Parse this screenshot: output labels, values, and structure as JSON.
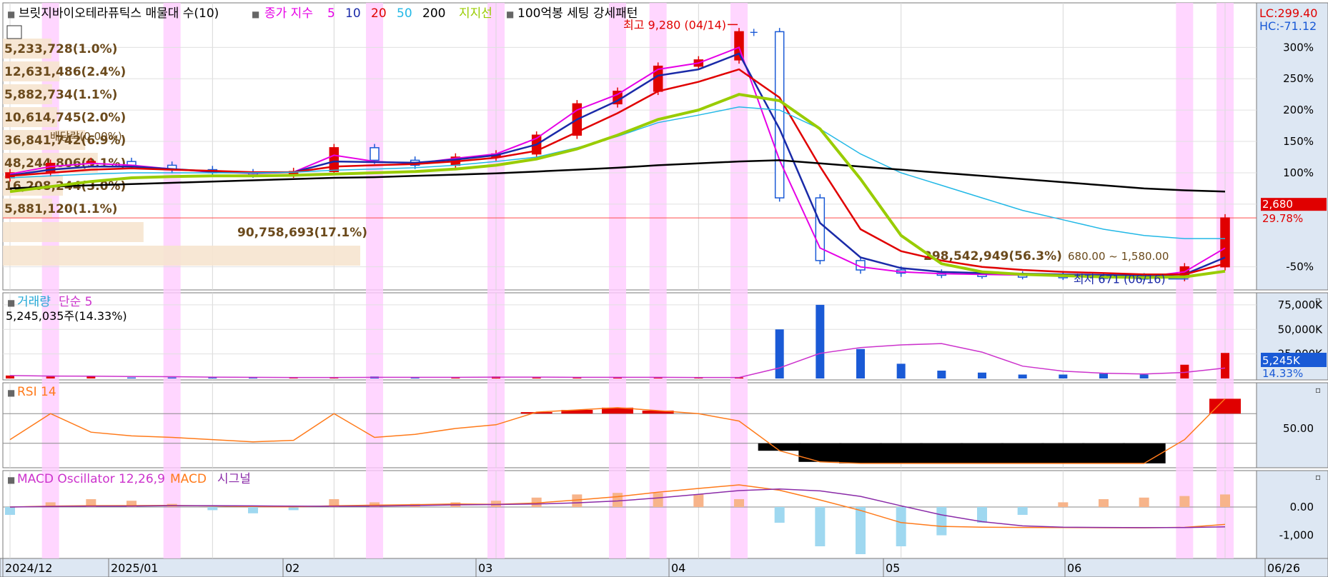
{
  "main_panel": {
    "title": "브릿지바이오테라퓨틱스 매물대 수(10)",
    "legend_prefix": "종가 지수",
    "ma_legend": [
      {
        "label": "5",
        "color": "#e600e6"
      },
      {
        "label": "10",
        "color": "#1a2aa8"
      },
      {
        "label": "20",
        "color": "#e00000"
      },
      {
        "label": "50",
        "color": "#22b8e6"
      },
      {
        "label": "200",
        "color": "#000000"
      }
    ],
    "support_label": "지지선",
    "support_color": "#99cc00",
    "pattern_label": "100억봉 세팅 강세패턴",
    "lc": "LC:299.40",
    "hc": "HC:-71.12",
    "high_annotation": "최고 9,280 (04/14)",
    "low_annotation": "최저 671 (06/16)",
    "dividend_annotation": "배당락(0.00%)",
    "range_annotation": "680.00 ~ 1,580.00",
    "current_price": "2,680",
    "current_pct": "29.78%",
    "y_ticks": [
      "300%",
      "250%",
      "200%",
      "150%",
      "100%",
      "50%",
      "-50%"
    ]
  },
  "volume_profile": [
    {
      "label": "5,233,728(1.0%)",
      "share": 1.0
    },
    {
      "label": "12,631,486(2.4%)",
      "share": 2.4
    },
    {
      "label": "5,882,734(1.1%)",
      "share": 1.1
    },
    {
      "label": "10,614,745(2.0%)",
      "share": 2.0
    },
    {
      "label": "36,841,742(6.9%)",
      "share": 6.9
    },
    {
      "label": "48,244,806(9.1%)",
      "share": 9.1
    },
    {
      "label": "16,208,244(3.0%)",
      "share": 3.0
    },
    {
      "label": "5,881,120(1.1%)",
      "share": 1.1
    },
    {
      "label": "90,758,693(17.1%)",
      "share": 17.1
    },
    {
      "label": "298,542,949(56.3%)",
      "share": 56.3
    }
  ],
  "volume_panel": {
    "title": "거래량",
    "ma_label": "단순 5",
    "summary": "5,245,035주(14.33%)",
    "y_ticks": [
      "75,000K",
      "50,000K",
      "25,000K"
    ],
    "current_value": "5,245K",
    "current_pct": "14.33%"
  },
  "rsi_panel": {
    "title": "RSI 14",
    "y_tick": "50.00"
  },
  "macd_panel": {
    "title": "MACD Oscillator 12,26,9",
    "macd_label": "MACD",
    "signal_label": "시그널",
    "y_ticks": [
      "0.00",
      "-1,000"
    ]
  },
  "x_axis": {
    "labels": [
      "2024/12",
      "2025/01",
      "02",
      "03",
      "04",
      "05",
      "06",
      "06/26"
    ]
  },
  "chart_data": {
    "type": "line",
    "title": "브릿지바이오테라퓨틱스",
    "x": [
      "2024-12-09",
      "2024-12-16",
      "2024-12-23",
      "2024-12-30",
      "2025-01-06",
      "2025-01-13",
      "2025-01-20",
      "2025-01-31",
      "2025-02-07",
      "2025-02-14",
      "2025-02-21",
      "2025-02-28",
      "2025-03-07",
      "2025-03-14",
      "2025-03-21",
      "2025-03-28",
      "2025-04-04",
      "2025-04-09",
      "2025-04-14",
      "2025-04-18",
      "2025-04-25",
      "2025-05-02",
      "2025-05-09",
      "2025-05-16",
      "2025-05-23",
      "2025-05-30",
      "2025-06-05",
      "2025-06-12",
      "2025-06-16",
      "2025-06-20",
      "2025-06-26"
    ],
    "series": [
      {
        "name": "종가",
        "values": [
          100,
          115,
          118,
          112,
          105,
          100,
          98,
          102,
          140,
          120,
          112,
          125,
          130,
          160,
          210,
          230,
          270,
          280,
          325,
          60,
          -40,
          -55,
          -60,
          -62,
          -63,
          -64,
          -65,
          -66,
          -67,
          -50,
          28
        ]
      },
      {
        "name": "5",
        "values": [
          98,
          110,
          115,
          112,
          106,
          101,
          99,
          101,
          128,
          118,
          115,
          123,
          130,
          155,
          200,
          225,
          265,
          275,
          300,
          120,
          -20,
          -50,
          -58,
          -61,
          -62,
          -63,
          -64,
          -65,
          -66,
          -58,
          -20
        ]
      },
      {
        "name": "10",
        "values": [
          96,
          105,
          110,
          110,
          106,
          102,
          100,
          101,
          118,
          117,
          116,
          121,
          128,
          145,
          185,
          215,
          255,
          265,
          290,
          170,
          20,
          -35,
          -52,
          -58,
          -60,
          -61,
          -62,
          -63,
          -64,
          -62,
          -35
        ]
      },
      {
        "name": "20",
        "values": [
          95,
          100,
          105,
          107,
          105,
          103,
          101,
          101,
          110,
          112,
          114,
          118,
          124,
          135,
          165,
          195,
          230,
          245,
          265,
          220,
          110,
          10,
          -25,
          -40,
          -50,
          -55,
          -58,
          -60,
          -62,
          -62,
          -45
        ]
      },
      {
        "name": "50",
        "values": [
          92,
          95,
          98,
          100,
          100,
          100,
          100,
          101,
          104,
          106,
          108,
          112,
          118,
          125,
          140,
          158,
          180,
          192,
          205,
          200,
          170,
          130,
          100,
          80,
          60,
          40,
          25,
          10,
          0,
          -5,
          -5
        ]
      },
      {
        "name": "200",
        "values": [
          75,
          78,
          80,
          82,
          84,
          86,
          88,
          90,
          92,
          93,
          95,
          97,
          99,
          102,
          105,
          108,
          112,
          115,
          118,
          120,
          115,
          110,
          105,
          100,
          95,
          90,
          85,
          80,
          75,
          72,
          70
        ]
      },
      {
        "name": "지지선",
        "values": [
          70,
          78,
          86,
          92,
          94,
          95,
          95,
          96,
          98,
          100,
          102,
          106,
          112,
          122,
          138,
          160,
          185,
          200,
          225,
          215,
          170,
          90,
          0,
          -45,
          -58,
          -62,
          -64,
          -66,
          -67,
          -66,
          -57
        ]
      }
    ],
    "ylim": [
      -80,
      330
    ],
    "volume": [
      3,
      2,
      2,
      1,
      1,
      1,
      1,
      1,
      1,
      2,
      1,
      1,
      2,
      1,
      1,
      1,
      1,
      1,
      1,
      50,
      75,
      30,
      15,
      8,
      6,
      4,
      4,
      5,
      4,
      14,
      26
    ],
    "rsi": [
      35,
      70,
      45,
      40,
      38,
      35,
      32,
      34,
      70,
      38,
      42,
      50,
      55,
      72,
      75,
      78,
      74,
      70,
      60,
      20,
      5,
      3,
      3,
      3,
      3,
      3,
      3,
      3,
      3,
      35,
      90
    ],
    "macd_osc": [
      -5,
      3,
      5,
      4,
      2,
      -2,
      -4,
      -2,
      5,
      3,
      2,
      3,
      4,
      6,
      8,
      9,
      9,
      8,
      5,
      -10,
      -25,
      -30,
      -25,
      -18,
      -10,
      -5,
      3,
      5,
      6,
      7,
      8
    ]
  }
}
